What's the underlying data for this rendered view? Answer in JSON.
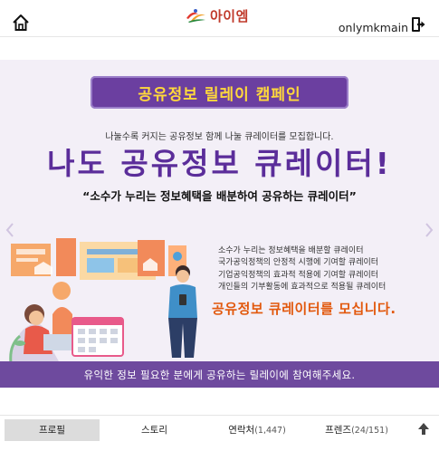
{
  "header": {
    "logo_text": "아이엠",
    "username": "onlymkmain"
  },
  "banner": {
    "pill_title": "공유정보 릴레이 캠페인",
    "subtitle": "나눌수록  커지는 공유정보 함께 나눌 큐레이터를 모집합니다.",
    "headline": "나도 공유정보 큐레이터!",
    "quote": "“소수가 누리는 정보혜택을 배분하여 공유하는 큐레이터”",
    "details": [
      "소수가 누리는 정보혜택을 배분할 큐레이터",
      "국가공익정책의 안정적 시행에 기여할 큐레이터",
      "기업공익정책의 효과적 적용에 기여할 큐레이터",
      "개인들의 기부활동에 효과적으로 적용될 큐레이터"
    ],
    "cta": "공유정보 큐레이터를 모십니다.",
    "footer": "유익한 정보 필요한 분에게 공유하는 릴레이에 참여해주세요."
  },
  "tabs": [
    {
      "label": "프로필",
      "count": ""
    },
    {
      "label": "스토리",
      "count": ""
    },
    {
      "label": "연락처",
      "count": "(1,447)"
    },
    {
      "label": "프렌즈",
      "count": "(24/151)"
    }
  ],
  "colors": {
    "brand_purple": "#6b3fa0",
    "headline_purple": "#5b2d9a",
    "cta_orange": "#e2580d",
    "pill_text_yellow": "#ffd93b",
    "logo_red": "#c03a2b"
  }
}
